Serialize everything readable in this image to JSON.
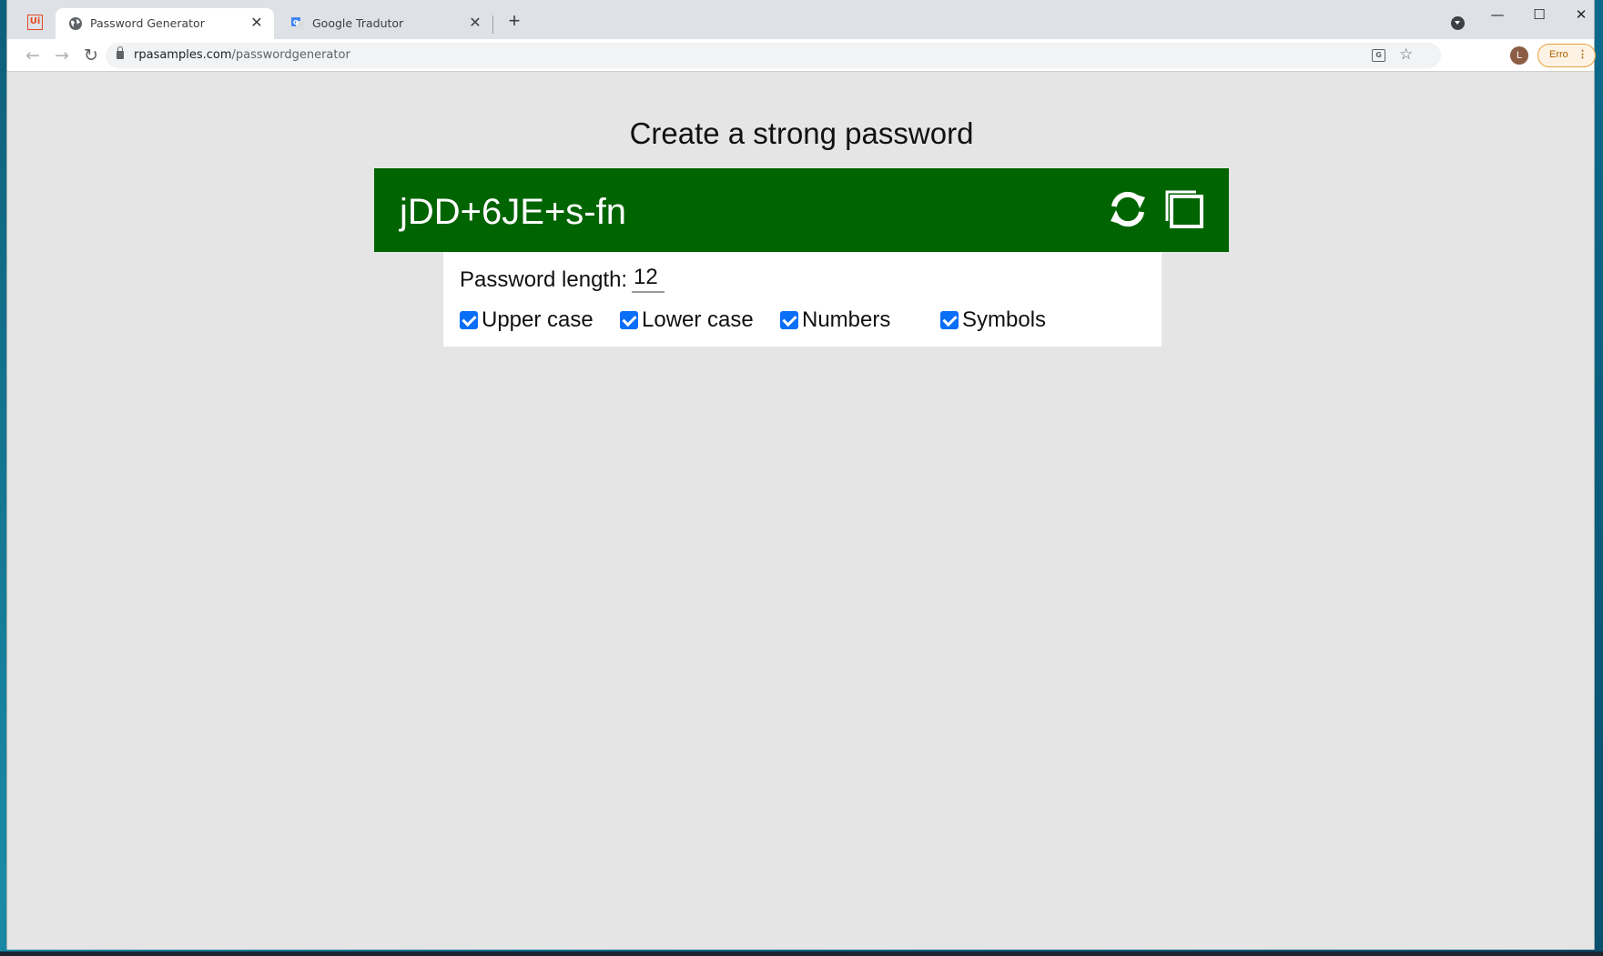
{
  "browser": {
    "tabs": [
      {
        "title": "Password Generator",
        "icon": "globe-icon",
        "active": true
      },
      {
        "title": "Google Tradutor",
        "icon": "google-translate-icon",
        "active": false
      }
    ],
    "new_tab": "+",
    "address": {
      "host": "rpasamples.com",
      "path": "/passwordgenerator"
    },
    "profile_initial": "L",
    "error_label": "Erro",
    "window_controls": {
      "minimize": "—",
      "maximize": "☐",
      "close": "✕"
    }
  },
  "page": {
    "heading": "Create a strong password",
    "password": "jDD+6JE+s-fn",
    "length_label": "Password length:",
    "length_value": "12",
    "options": [
      {
        "label": "Upper case",
        "checked": true
      },
      {
        "label": "Lower case",
        "checked": true
      },
      {
        "label": "Numbers",
        "checked": true
      },
      {
        "label": "Symbols",
        "checked": true
      }
    ]
  },
  "colors": {
    "password_bar": "#006400",
    "checkbox": "#0b6ef7",
    "page_bg": "#e5e5e5"
  }
}
